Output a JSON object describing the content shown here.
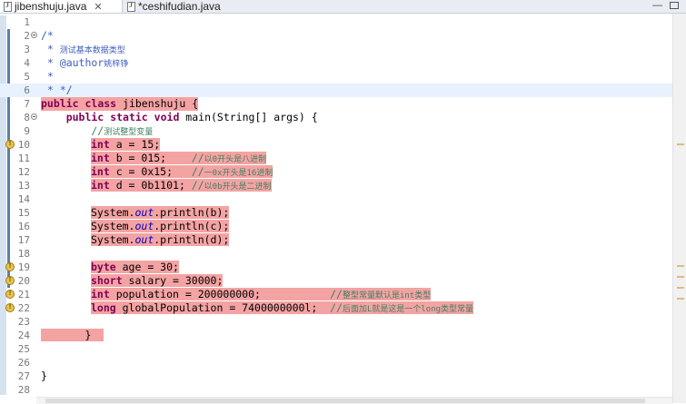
{
  "tabs": [
    {
      "label": "jibenshuju.java",
      "close": "✕"
    },
    {
      "label": "*ceshifudian.java"
    }
  ],
  "window": {
    "min_label": "—"
  },
  "line_numbers": [
    "1",
    "2",
    "3",
    "4",
    "5",
    "6",
    "7",
    "8",
    "9",
    "10",
    "11",
    "12",
    "13",
    "14",
    "15",
    "16",
    "17",
    "18",
    "19",
    "20",
    "21",
    "22",
    "23",
    "24",
    "25",
    "26",
    "27",
    "28"
  ],
  "code": {
    "l2": "/*",
    "l3a": " * ",
    "l3b": "测试基本数据类型",
    "l4a": " * @author",
    "l4b": "姚梓铮",
    "l5": " *",
    "l6": " * */",
    "l7a": "public",
    "l7b": " ",
    "l7c": "class",
    "l7d": " jibenshuju {",
    "l8a": "    public",
    "l8b": " ",
    "l8c": "static",
    "l8d": " ",
    "l8e": "void",
    "l8f": " main(String[] args) {",
    "l9a": "        //",
    "l9b": "测试整型变量",
    "l10a": "int",
    "l10b": " a = 15;",
    "l11a": "int",
    "l11b": " b = 015;    ",
    "l11c": "//",
    "l11d": "以0开头是八进制",
    "l12a": "int",
    "l12b": " c = 0x15;   ",
    "l12c": "//",
    "l12d": "一0x开头是16进制",
    "l13a": "int",
    "l13b": " d = 0b1101; ",
    "l13c": "//",
    "l13d": "以0b开头是二进制",
    "l15a": "System.",
    "l15b": "out",
    "l15c": ".println(b);",
    "l16a": "System.",
    "l16b": "out",
    "l16c": ".println(c);",
    "l17a": "System.",
    "l17b": "out",
    "l17c": ".println(d);",
    "l19a": "byte",
    "l19b": " age = 30;",
    "l20a": "short",
    "l20b": " salary = 30000;",
    "l21a": "int",
    "l21b": " population = 200000000;           ",
    "l21c": "//",
    "l21d": "整型常量默认是int类型",
    "l22a": "long",
    "l22b": " globalPopulation = 7400000000l;  ",
    "l22c": "//",
    "l22d": "后面加L就是这是一个long类型常量",
    "l24": "}",
    "l27": "}"
  },
  "icons": {
    "file": "java-file-icon",
    "warning": "warning-icon",
    "fold": "fold-toggle-icon"
  }
}
